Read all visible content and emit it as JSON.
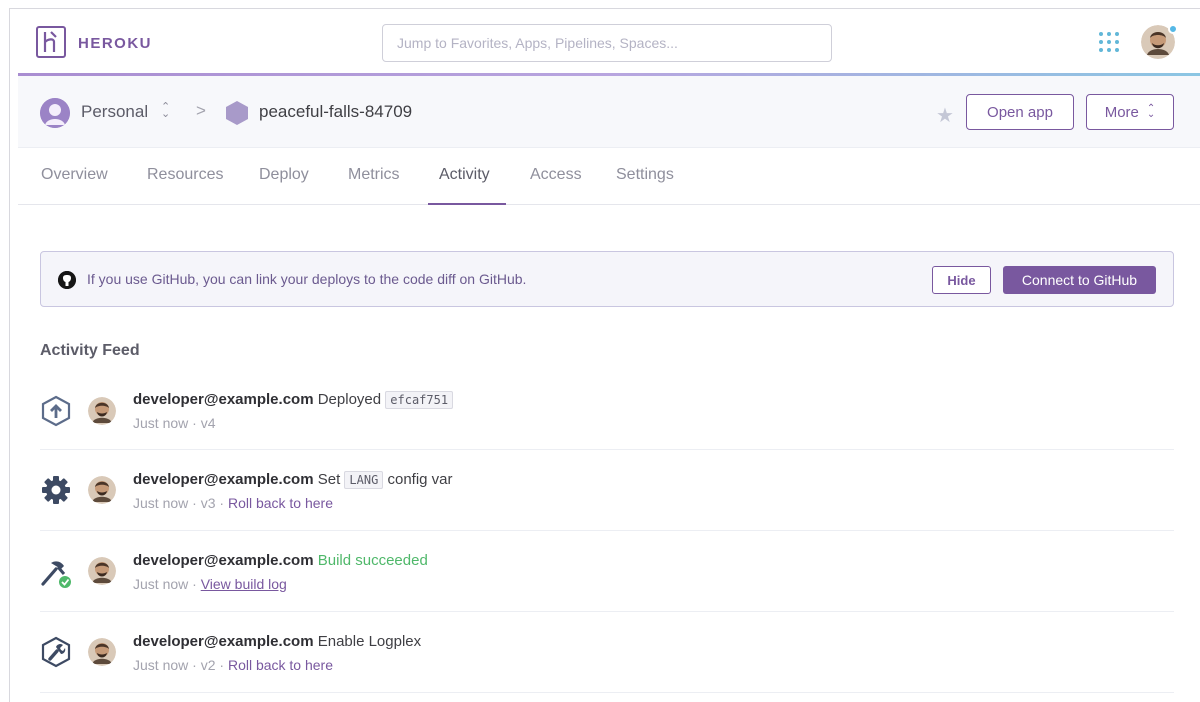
{
  "brand": {
    "name": "HEROKU"
  },
  "search": {
    "placeholder": "Jump to Favorites, Apps, Pipelines, Spaces..."
  },
  "header": {
    "account": "Personal",
    "separator": ">",
    "app_name": "peaceful-falls-84709",
    "open_app_label": "Open app",
    "more_label": "More"
  },
  "tabs": [
    {
      "label": "Overview"
    },
    {
      "label": "Resources"
    },
    {
      "label": "Deploy"
    },
    {
      "label": "Metrics"
    },
    {
      "label": "Activity",
      "active": true
    },
    {
      "label": "Access"
    },
    {
      "label": "Settings"
    }
  ],
  "banner": {
    "text": "If you use GitHub, you can link your deploys to the code diff on GitHub.",
    "hide_label": "Hide",
    "connect_label": "Connect to GitHub"
  },
  "feed": {
    "title": "Activity Feed",
    "items": [
      {
        "icon": "deploy-icon",
        "user": "developer@example.com",
        "action": "Deployed",
        "code": "efcaf751",
        "time": "Just now",
        "version": "v4"
      },
      {
        "icon": "gear-icon",
        "user": "developer@example.com",
        "action": "Set",
        "code": "LANG",
        "action_suffix": "config var",
        "time": "Just now",
        "version": "v3",
        "link": "Roll back to here"
      },
      {
        "icon": "build-icon",
        "user": "developer@example.com",
        "action": "Build succeeded",
        "time": "Just now",
        "link": "View build log"
      },
      {
        "icon": "wrench-icon",
        "user": "developer@example.com",
        "action": "Enable Logplex",
        "time": "Just now",
        "version": "v2",
        "link": "Roll back to here"
      }
    ],
    "dot": " · "
  },
  "colors": {
    "brand": "#79589f",
    "success": "#4fb86a",
    "accent_blue": "#62b7d8"
  }
}
